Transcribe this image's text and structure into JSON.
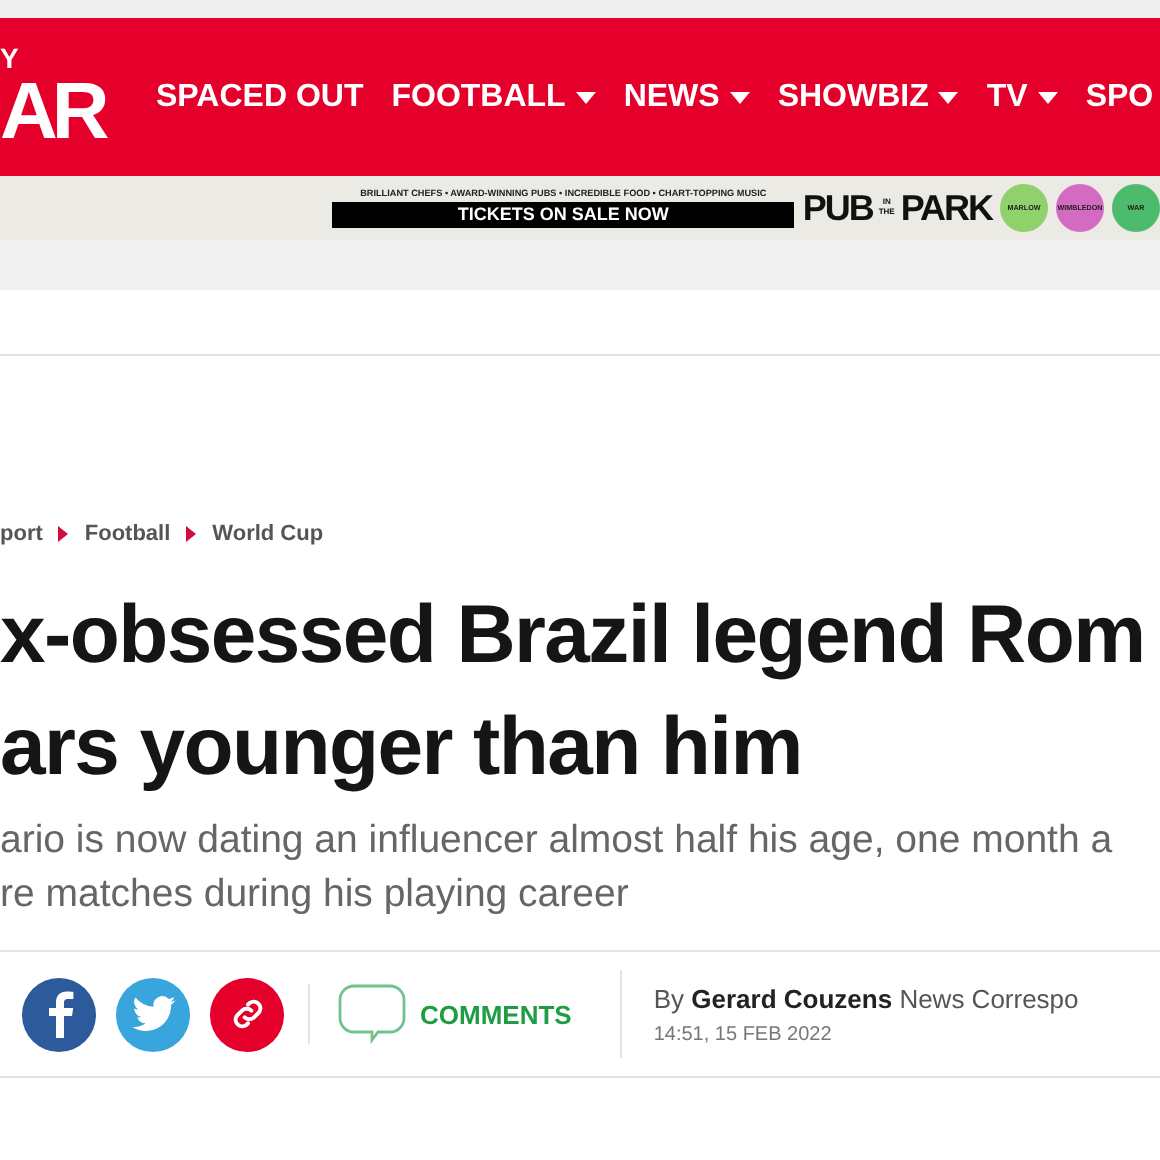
{
  "logo": {
    "top": "Y",
    "main": "AR"
  },
  "nav": [
    {
      "label": "SPACED OUT",
      "dropdown": false
    },
    {
      "label": "FOOTBALL",
      "dropdown": true
    },
    {
      "label": "NEWS",
      "dropdown": true
    },
    {
      "label": "SHOWBIZ",
      "dropdown": true
    },
    {
      "label": "TV",
      "dropdown": true
    },
    {
      "label": "SPO",
      "dropdown": false
    }
  ],
  "ad": {
    "tagline": "BRILLIANT CHEFS • AWARD-WINNING PUBS • INCREDIBLE FOOD • CHART-TOPPING MUSIC",
    "cta": "TICKETS ON SALE NOW",
    "brand_left": "PUB",
    "brand_mid": "IN THE",
    "brand_right": "PARK",
    "venues": [
      {
        "label": "MARLOW",
        "color": "#8fd16a"
      },
      {
        "label": "WIMBLEDON",
        "color": "#d36bc2"
      },
      {
        "label": "WAR",
        "color": "#4cbb6c"
      }
    ]
  },
  "breadcrumbs": [
    "port",
    "Football",
    "World Cup"
  ],
  "headline": [
    "x-obsessed Brazil legend Rom",
    "ars younger than him"
  ],
  "standfirst": [
    "ario is now dating an influencer almost half his age, one month a",
    "re matches during his playing career"
  ],
  "share": {
    "comments": "COMMENTS"
  },
  "byline": {
    "prefix": "By",
    "author": "Gerard Couzens",
    "role": "News Correspo",
    "date": "14:51, 15 FEB 2022"
  }
}
